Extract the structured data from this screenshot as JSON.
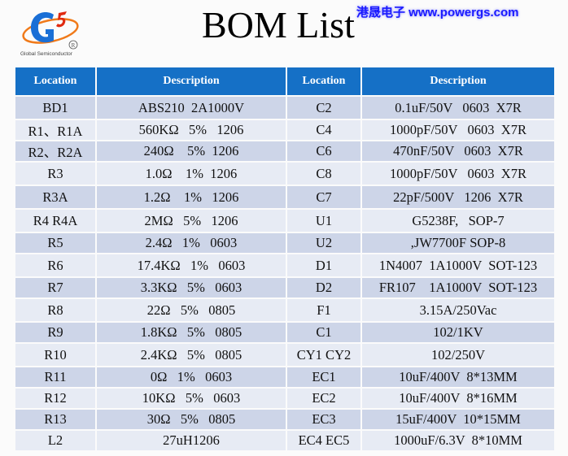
{
  "header": {
    "title": "BOM List",
    "brand_text": "港晟电子  www.powergs.com",
    "logo": {
      "icon": "g5-logo-icon",
      "registered_mark": "R",
      "caption": "Global Semiconductor",
      "colors": {
        "blue": "#1a6fd6",
        "orange": "#f07a1a",
        "red": "#e02a10"
      }
    }
  },
  "table": {
    "columns": [
      "Location",
      "Description",
      "Location",
      "Description"
    ],
    "header_color": "#1570c6",
    "row_colors": [
      "#cdd5e8",
      "#e7ebf4"
    ],
    "rows": [
      {
        "loc1": "BD1",
        "desc1": "ABS210  2A1000V",
        "loc2": "C2",
        "desc2": "0.1uF/50V   0603  X7R"
      },
      {
        "loc1": "R1、R1A",
        "desc1": "560KΩ   5%   1206",
        "loc2": "C4",
        "desc2": "1000pF/50V   0603  X7R"
      },
      {
        "loc1": "R2、R2A",
        "desc1": "240Ω    5%  1206",
        "loc2": "C6",
        "desc2": "470nF/50V   0603  X7R"
      },
      {
        "loc1": "R3",
        "desc1": "1.0Ω    1%  1206",
        "loc2": "C8",
        "desc2": "1000pF/50V   0603  X7R"
      },
      {
        "loc1": "R3A",
        "desc1": "1.2Ω    1%   1206",
        "loc2": "C7",
        "desc2": "22pF/500V   1206  X7R"
      },
      {
        "loc1": "R4 R4A",
        "desc1": "2MΩ   5%   1206",
        "loc2": "U1",
        "desc2": "G5238F,   SOP-7"
      },
      {
        "loc1": "R5",
        "desc1": "2.4Ω   1%   0603",
        "loc2": "U2",
        "desc2": ",JW7700F SOP-8"
      },
      {
        "loc1": "R6",
        "desc1": "17.4KΩ   1%   0603",
        "loc2": "D1",
        "desc2": "1N4007  1A1000V  SOT-123"
      },
      {
        "loc1": "R7",
        "desc1": "3.3KΩ   5%   0603",
        "loc2": "D2",
        "desc2": "FR107    1A1000V  SOT-123"
      },
      {
        "loc1": "R8",
        "desc1": "22Ω   5%   0805",
        "loc2": "F1",
        "desc2": "3.15A/250Vac"
      },
      {
        "loc1": "R9",
        "desc1": "1.8KΩ   5%   0805",
        "loc2": "C1",
        "desc2": "102/1KV"
      },
      {
        "loc1": "R10",
        "desc1": "2.4KΩ   5%   0805",
        "loc2": "CY1 CY2",
        "desc2": "102/250V"
      },
      {
        "loc1": "R11",
        "desc1": "0Ω   1%   0603",
        "loc2": "EC1",
        "desc2": "10uF/400V  8*13MM"
      },
      {
        "loc1": "R12",
        "desc1": "10KΩ   5%   0603",
        "loc2": "EC2",
        "desc2": "10uF/400V  8*16MM"
      },
      {
        "loc1": "R13",
        "desc1": "30Ω   5%   0805",
        "loc2": "EC3",
        "desc2": "15uF/400V  10*15MM"
      },
      {
        "loc1": "L2",
        "desc1": "27uH1206",
        "loc2": "EC4 EC5",
        "desc2": "1000uF/6.3V  8*10MM"
      }
    ]
  }
}
